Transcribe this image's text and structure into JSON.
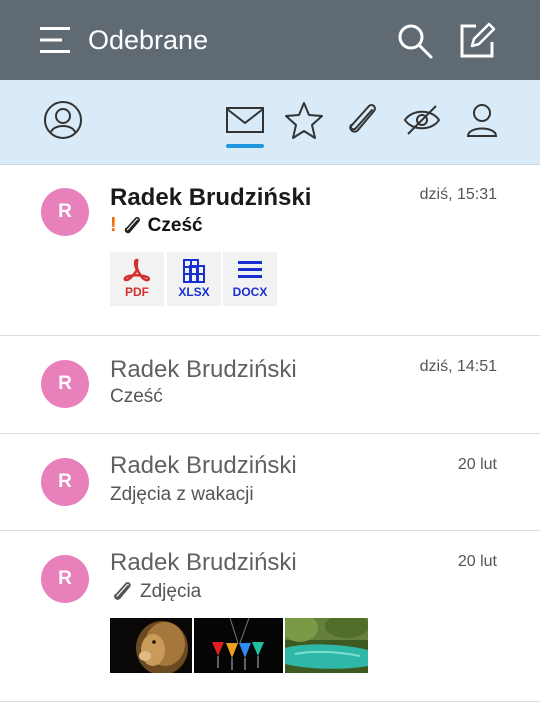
{
  "appbar": {
    "title": "Odebrane"
  },
  "filters": [
    "account-icon",
    "mail-icon",
    "star-icon",
    "paperclip-icon",
    "eye-off-icon",
    "person-icon"
  ],
  "messages": [
    {
      "avatar": "R",
      "sender": "Radek Brudziński",
      "date": "dziś, 15:31",
      "subject": "Cześć",
      "important": true,
      "unread": true,
      "attachments": [
        {
          "label": "PDF",
          "color": "#d32f2f"
        },
        {
          "label": "XLSX",
          "color": "#1a2fd0"
        },
        {
          "label": "DOCX",
          "color": "#1a2fd0"
        }
      ]
    },
    {
      "avatar": "R",
      "sender": "Radek Brudziński",
      "date": "dziś, 14:51",
      "subject": "Cześć",
      "unread": false
    },
    {
      "avatar": "R",
      "sender": "Radek Brudziński",
      "date": "20 lut",
      "subject": "Zdjęcia z wakacji",
      "unread": false
    },
    {
      "avatar": "R",
      "sender": "Radek Brudziński",
      "date": "20 lut",
      "subject": "Zdjęcia",
      "unread": false,
      "images": [
        "lion",
        "cocktails",
        "lagoon"
      ]
    }
  ],
  "colors": {
    "appbar": "#5f6a72",
    "filterbar": "#d9ebf8",
    "avatar": "#e880bc",
    "selected": "#2196e0"
  }
}
